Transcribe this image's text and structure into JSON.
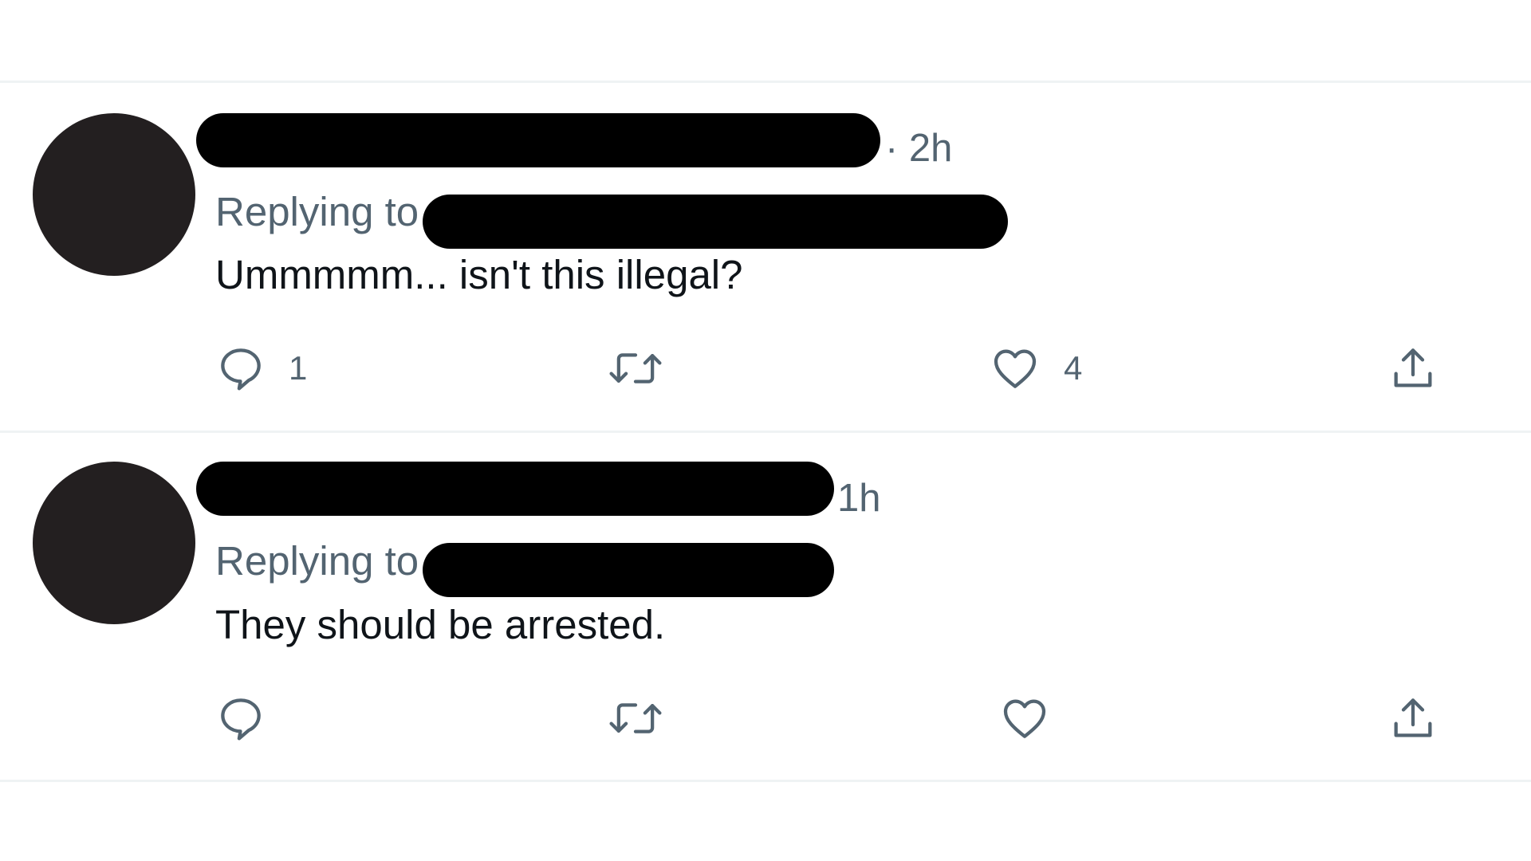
{
  "colors": {
    "secondary_text": "#536471",
    "primary_text": "#0f1419",
    "avatar": "#231f20",
    "redaction": "#000000",
    "divider": "#eff3f4"
  },
  "tweets": [
    {
      "time": "· 2h",
      "replying_label": "Replying to",
      "text": "Ummmmm... isn't this illegal?",
      "reply_count": "1",
      "retweet_count": "",
      "like_count": "4",
      "icons": [
        "reply-icon",
        "retweet-icon",
        "like-icon",
        "share-icon"
      ]
    },
    {
      "time": "1h",
      "replying_label": "Replying to",
      "text": "They should be arrested.",
      "reply_count": "",
      "retweet_count": "",
      "like_count": "",
      "icons": [
        "reply-icon",
        "retweet-icon",
        "like-icon",
        "share-icon"
      ]
    }
  ]
}
